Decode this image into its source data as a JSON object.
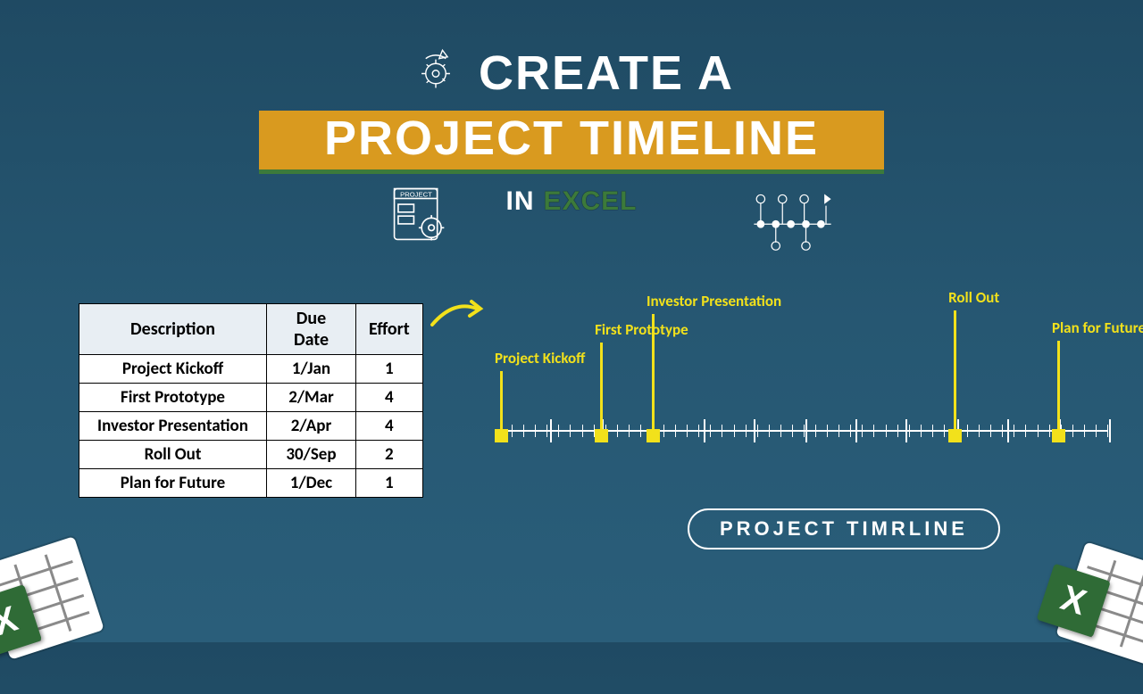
{
  "title": {
    "line1": "CREATE A",
    "line2": "PROJECT TIMELINE",
    "in": "IN",
    "excel": "EXCEL"
  },
  "table": {
    "headers": {
      "desc": "Description",
      "date": "Due Date",
      "effort": "Effort"
    },
    "rows": [
      {
        "desc": "Project Kickoff",
        "date": "1/Jan",
        "effort": "1"
      },
      {
        "desc": "First Prototype",
        "date": "2/Mar",
        "effort": "4"
      },
      {
        "desc": "Investor Presentation",
        "date": "2/Apr",
        "effort": "4"
      },
      {
        "desc": "Roll  Out",
        "date": "30/Sep",
        "effort": "2"
      },
      {
        "desc": "Plan for Future",
        "date": "1/Dec",
        "effort": "1"
      }
    ]
  },
  "chart_data": {
    "type": "timeline",
    "title": "PROJECT  TIMRLINE",
    "axis_range_days": [
      1,
      365
    ],
    "milestones": [
      {
        "label": "Project Kickoff",
        "date": "1/Jan",
        "day_of_year": 1,
        "stem_height": 72,
        "label_dx": -6
      },
      {
        "label": "First Prototype",
        "date": "2/Mar",
        "day_of_year": 61,
        "stem_height": 104,
        "label_dx": -6
      },
      {
        "label": "Investor Presentation",
        "date": "2/Apr",
        "day_of_year": 92,
        "stem_height": 136,
        "label_dx": -6
      },
      {
        "label": "Roll Out",
        "date": "30/Sep",
        "day_of_year": 273,
        "stem_height": 140,
        "label_dx": -6
      },
      {
        "label": "Plan for Future",
        "date": "1/Dec",
        "day_of_year": 335,
        "stem_height": 106,
        "label_dx": -6
      }
    ]
  },
  "caption": "PROJECT  TIMRLINE"
}
